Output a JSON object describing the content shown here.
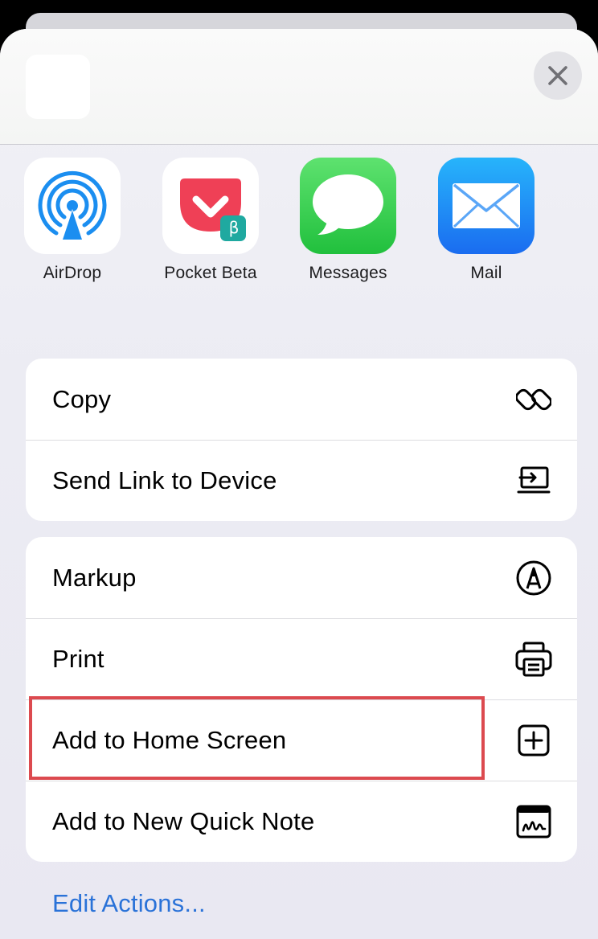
{
  "header": {
    "close_icon": "close-icon"
  },
  "apps": [
    {
      "label": "AirDrop",
      "icon": "airdrop-icon"
    },
    {
      "label": "Pocket Beta",
      "icon": "pocket-beta-icon",
      "badge": "β"
    },
    {
      "label": "Messages",
      "icon": "messages-icon"
    },
    {
      "label": "Mail",
      "icon": "mail-icon"
    }
  ],
  "group1": [
    {
      "label": "Copy",
      "icon": "copy-link-icon"
    },
    {
      "label": "Send Link to Device",
      "icon": "send-to-device-icon"
    }
  ],
  "group2": [
    {
      "label": "Markup",
      "icon": "markup-pen-icon"
    },
    {
      "label": "Print",
      "icon": "printer-icon"
    },
    {
      "label": "Add to Home Screen",
      "icon": "add-square-icon"
    },
    {
      "label": "Add to New Quick Note",
      "icon": "quick-note-icon"
    }
  ],
  "footer": {
    "edit_actions": "Edit Actions..."
  },
  "colors": {
    "accent": "#2a72d8",
    "highlight_border": "#dc4a4f",
    "messages_green": "#2ecf4a",
    "mail_blue": "#1a8af5",
    "pocket_red": "#ef4056",
    "airdrop_blue": "#1b8ef0"
  }
}
